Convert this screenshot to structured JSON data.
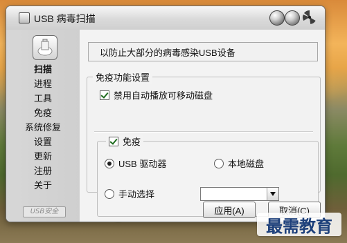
{
  "window": {
    "title": "USB 病毒扫描"
  },
  "sidebar": {
    "items": [
      {
        "label": "扫描"
      },
      {
        "label": "进程"
      },
      {
        "label": "工具"
      },
      {
        "label": "免疫"
      },
      {
        "label": "系统修复"
      },
      {
        "label": "设置"
      },
      {
        "label": "更新"
      },
      {
        "label": "注册"
      },
      {
        "label": "关于"
      }
    ],
    "footer": "USB安全"
  },
  "main": {
    "info_text": "以防止大部分的病毒感染USB设备",
    "group_title": "免疫功能设置",
    "disable_autoplay_label": "禁用自动播放可移动磁盘",
    "immunity_label": "免疫",
    "radio_usb_label": "USB 驱动器",
    "radio_local_label": "本地磁盘",
    "radio_manual_label": "手动选择",
    "manual_select_value": "",
    "buttons": {
      "apply": "应用(A)",
      "cancel": "取消(C)"
    }
  },
  "watermark": {
    "text": "最需教育"
  }
}
